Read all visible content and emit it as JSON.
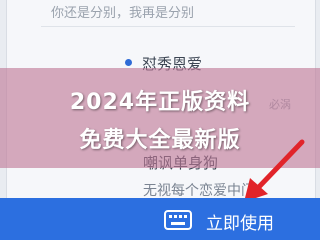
{
  "list": {
    "top_faded": "你还是分别，我再是分别",
    "items": [
      {
        "label": "怼秀恩爱"
      },
      {
        "label": "嘲讽单身狗"
      },
      {
        "label": "无视每个恋爱中门"
      }
    ],
    "side_faded": "必涡"
  },
  "banner": {
    "line1": "2024年正版资料",
    "line2": "免费大全最新版"
  },
  "cta": {
    "label": "立即使用",
    "icon": "keyboard-icon"
  },
  "colors": {
    "accent": "#2c6fe0",
    "overlay": "#be7896"
  }
}
